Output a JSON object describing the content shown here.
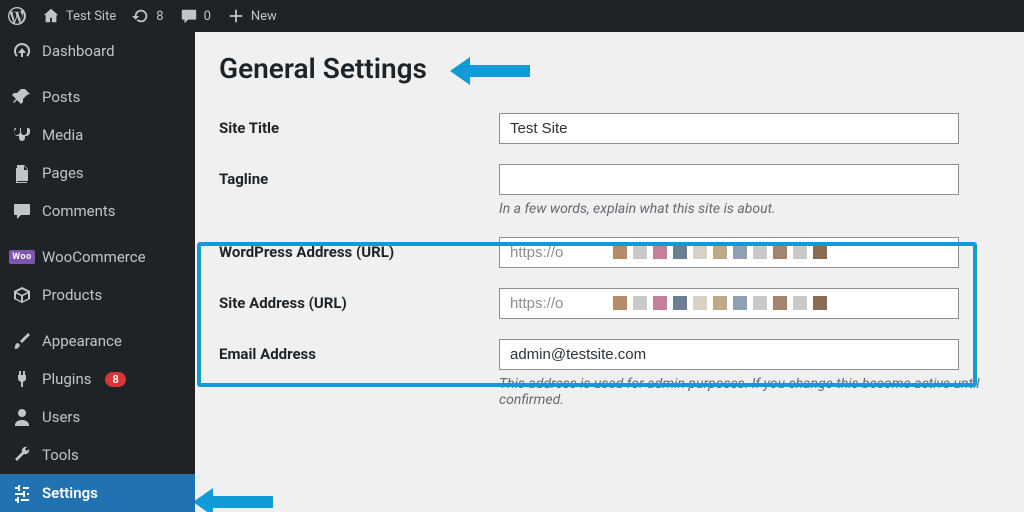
{
  "topbar": {
    "site_name": "Test Site",
    "updates_count": "8",
    "comments_count": "0",
    "new_label": "New"
  },
  "sidebar": {
    "items": [
      {
        "label": "Dashboard"
      },
      {
        "label": "Posts"
      },
      {
        "label": "Media"
      },
      {
        "label": "Pages"
      },
      {
        "label": "Comments"
      },
      {
        "label": "WooCommerce"
      },
      {
        "label": "Products"
      },
      {
        "label": "Appearance"
      },
      {
        "label": "Plugins",
        "badge": "8"
      },
      {
        "label": "Users"
      },
      {
        "label": "Tools"
      },
      {
        "label": "Settings"
      }
    ]
  },
  "page": {
    "title": "General Settings",
    "fields": {
      "site_title": {
        "label": "Site Title",
        "value": "Test Site"
      },
      "tagline": {
        "label": "Tagline",
        "value": "",
        "help": "In a few words, explain what this site is about."
      },
      "wp_url": {
        "label": "WordPress Address (URL)",
        "value": "https://o"
      },
      "site_url": {
        "label": "Site Address (URL)",
        "value": "https://o"
      },
      "email": {
        "label": "Email Address",
        "value": "admin@testsite.com",
        "help": "This address is used for admin purposes. If you change this become active until confirmed."
      }
    }
  }
}
